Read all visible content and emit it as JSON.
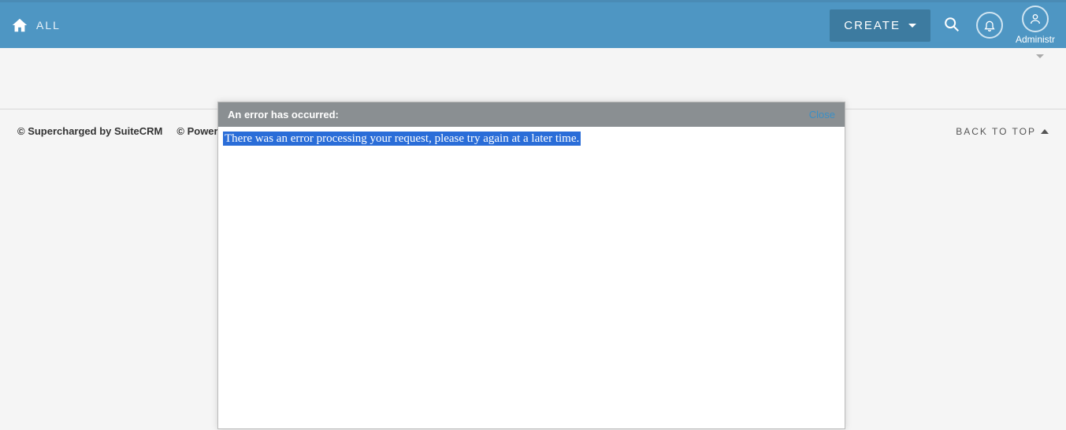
{
  "nav": {
    "all_label": "ALL",
    "create_label": "CREATE",
    "user_label": "Administr"
  },
  "footer": {
    "supercharged": "© Supercharged by SuiteCRM",
    "powered": "© Powered By Su",
    "back_to_top": "BACK TO TOP"
  },
  "modal": {
    "title": "An error has occurred:",
    "close": "Close",
    "message": "There was an error processing your request, please try again at a later time."
  }
}
